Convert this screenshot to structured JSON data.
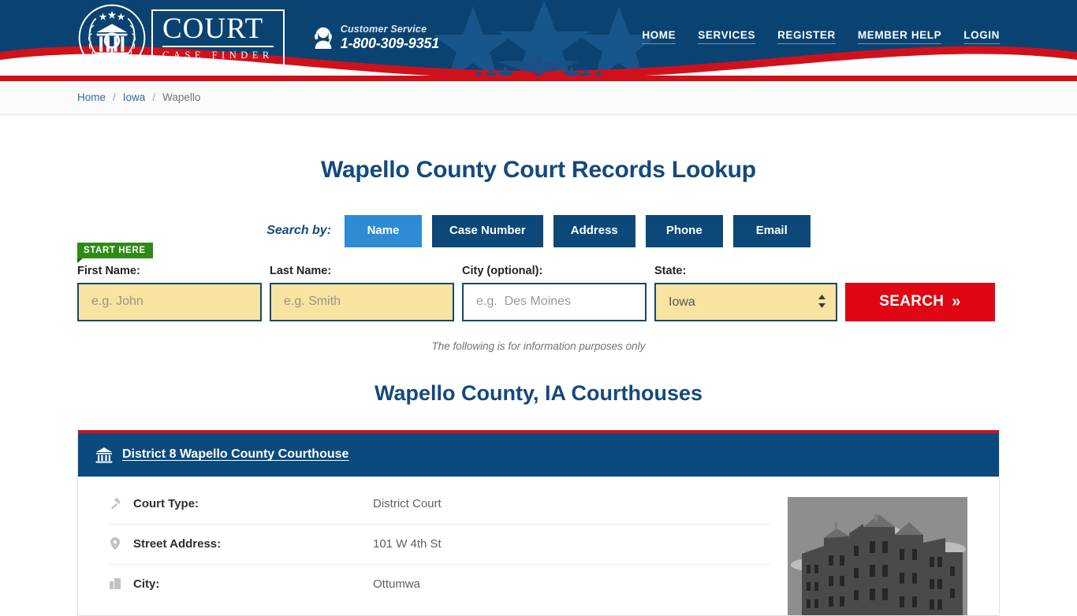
{
  "header": {
    "logo": {
      "title": "COURT",
      "subtitle": "CASE FINDER",
      "emblem_icon": "court-emblem-icon"
    },
    "customer_service": {
      "icon": "headset-support-icon",
      "label": "Customer Service",
      "phone": "1-800-309-9351"
    },
    "nav": [
      {
        "label": "HOME"
      },
      {
        "label": "SERVICES"
      },
      {
        "label": "REGISTER"
      },
      {
        "label": "MEMBER HELP"
      },
      {
        "label": "LOGIN"
      }
    ],
    "colors": {
      "navy": "#0a4372",
      "red": "#d0111b",
      "white": "#ffffff"
    }
  },
  "breadcrumb": {
    "items": [
      {
        "label": "Home",
        "current": false
      },
      {
        "label": "Iowa",
        "current": false
      },
      {
        "label": "Wapello",
        "current": true
      }
    ],
    "separator": "/"
  },
  "main": {
    "page_title": "Wapello County Court Records Lookup",
    "search_by": {
      "label": "Search by:",
      "tabs": [
        {
          "label": "Name",
          "active": true
        },
        {
          "label": "Case Number",
          "active": false
        },
        {
          "label": "Address",
          "active": false
        },
        {
          "label": "Phone",
          "active": false
        },
        {
          "label": "Email",
          "active": false
        }
      ]
    },
    "start_here_badge": "START HERE",
    "form": {
      "first_name": {
        "label": "First Name:",
        "placeholder": "e.g. John",
        "value": ""
      },
      "last_name": {
        "label": "Last Name:",
        "placeholder": "e.g. Smith",
        "value": ""
      },
      "city": {
        "label": "City (optional):",
        "placeholder": "e.g.  Des Moines",
        "value": ""
      },
      "state": {
        "label": "State:",
        "selected": "Iowa",
        "options": [
          "Iowa"
        ]
      },
      "search_button": {
        "label": "SEARCH",
        "chevron": "»"
      }
    },
    "disclaimer": "The following is for information purposes only",
    "section_title": "Wapello County, IA Courthouses",
    "courthouse": {
      "icon": "bank-courthouse-icon",
      "name": "District 8 Wapello County Courthouse",
      "photo_alt": "courthouse-photo",
      "rows": [
        {
          "icon": "gavel-icon",
          "label": "Court Type:",
          "value": "District Court"
        },
        {
          "icon": "map-pin-icon",
          "label": "Street Address:",
          "value": "101 W 4th St"
        },
        {
          "icon": "city-icon",
          "label": "City:",
          "value": "Ottumwa"
        }
      ]
    },
    "colors": {
      "heading": "#14497d",
      "tab_active": "#2e8bd4",
      "tab": "#0c4878",
      "search_red": "#e00613",
      "badge_green": "#2e8b16",
      "input_yellow": "#f8e3a0"
    }
  }
}
